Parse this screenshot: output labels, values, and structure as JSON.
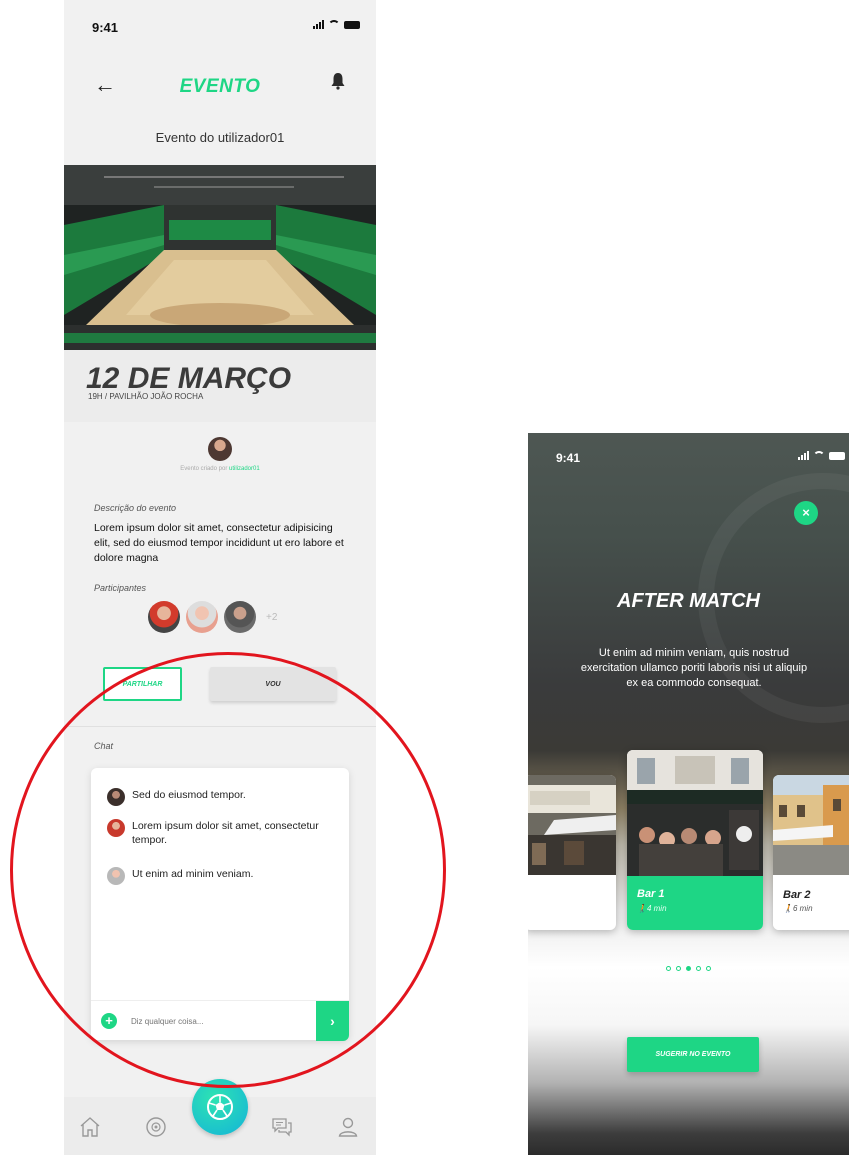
{
  "colors": {
    "accent": "#1ed685",
    "annotation": "#e2151e"
  },
  "left": {
    "status": {
      "time": "9:41"
    },
    "header": {
      "title": "EVENTO",
      "back_icon": "arrow-left-icon",
      "bell_icon": "bell-icon"
    },
    "subtitle": "Evento do utilizador01",
    "event": {
      "date": "12 DE MARÇO",
      "time_place": "19H / PAVILHÃO JOÃO ROCHA",
      "creator_prefix": "Evento criado por",
      "creator_user": "utilizador01",
      "description_label": "Descrição do evento",
      "description": "Lorem ipsum dolor sit amet, consectetur adipisicing elit, sed do eiusmod tempor incididunt ut ero labore et dolore magna",
      "participants_label": "Participantes",
      "participants_more": "+2"
    },
    "buttons": {
      "share": "PARTILHAR",
      "going": "VOU"
    },
    "chat": {
      "label": "Chat",
      "messages": [
        {
          "text": "Sed do eiusmod tempor."
        },
        {
          "text": "Lorem ipsum dolor sit amet, consectetur tempor."
        },
        {
          "text": "Ut enim ad minim veniam."
        }
      ],
      "input_placeholder": "Diz qualquer coisa..."
    },
    "tabbar": [
      "home-icon",
      "explore-icon",
      "ball-icon",
      "chat-icon",
      "profile-icon"
    ]
  },
  "right": {
    "status": {
      "time": "9:41"
    },
    "title": "AFTER MATCH",
    "text": "Ut enim ad minim veniam, quis nostrud exercitation ullamco poriti laboris nisi ut aliquip ex ea commodo consequat.",
    "bars": [
      {
        "name": "Bar 1",
        "time": "4 min"
      },
      {
        "name": "Bar 2",
        "time": "6 min"
      }
    ],
    "dots_count": 5,
    "dots_active_index": 2,
    "suggest_button": "SUGERIR NO EVENTO"
  }
}
